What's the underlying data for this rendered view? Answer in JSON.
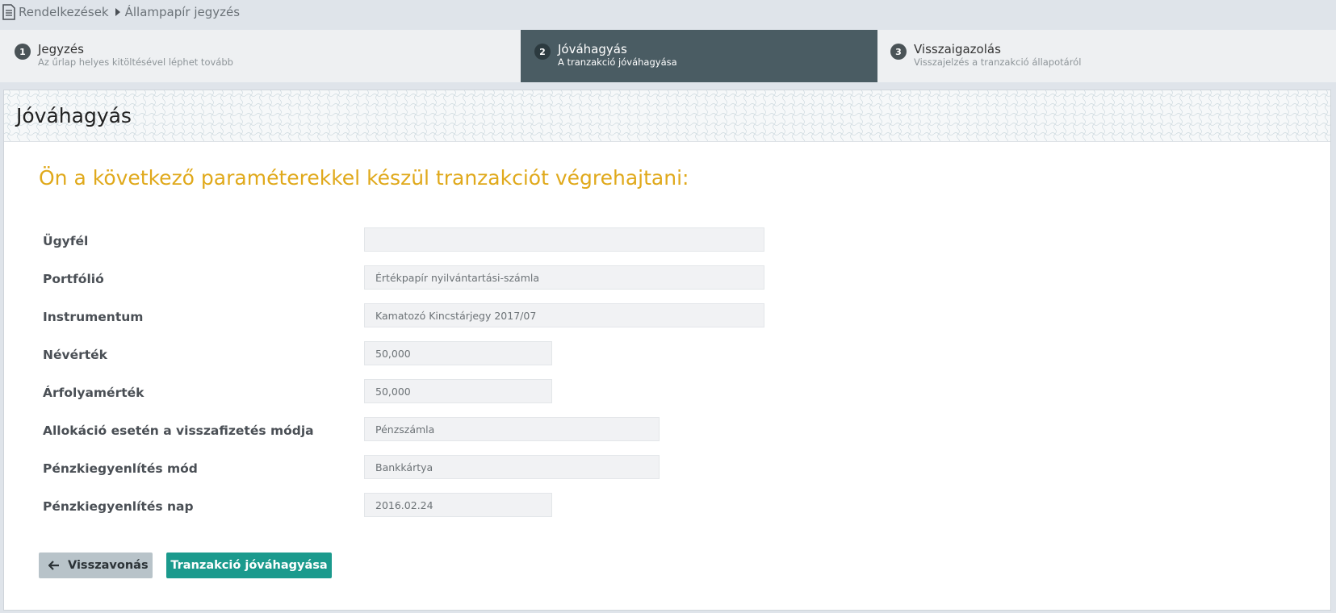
{
  "breadcrumb": {
    "icon": "document-icon",
    "items": [
      "Rendelkezések",
      "Állampapír jegyzés"
    ]
  },
  "steps": [
    {
      "number": "1",
      "title": "Jegyzés",
      "subtitle": "Az űrlap helyes kitöltésével léphet tovább",
      "active": false
    },
    {
      "number": "2",
      "title": "Jóváhagyás",
      "subtitle": "A tranzakció jóváhagyása",
      "active": true
    },
    {
      "number": "3",
      "title": "Visszaigazolás",
      "subtitle": "Visszajelzés a tranzakció állapotáról",
      "active": false
    }
  ],
  "panel": {
    "title": "Jóváhagyás",
    "intro": "Ön a következő paraméterekkel készül tranzakciót végrehajtani:"
  },
  "fields": [
    {
      "label": "Ügyfél",
      "value": ""
    },
    {
      "label": "Portfólió",
      "value": "Értékpapír nyilvántartási-számla"
    },
    {
      "label": "Instrumentum",
      "value": "Kamatozó Kincstárjegy 2017/07"
    },
    {
      "label": "Névérték",
      "value": "50,000"
    },
    {
      "label": "Árfolyamérték",
      "value": "50,000"
    },
    {
      "label": "Allokáció esetén a visszafizetés módja",
      "value": "Pénzszámla"
    },
    {
      "label": "Pénzkiegyenlítés mód",
      "value": "Bankkártya"
    },
    {
      "label": "Pénzkiegyenlítés nap",
      "value": "2016.02.24"
    }
  ],
  "buttons": {
    "back_label": "Visszavonás",
    "back_icon": "arrow-left-icon",
    "confirm_label": "Tranzakció jóváhagyása"
  },
  "colors": {
    "accent": "#e0a91b",
    "active_step": "#4a5c63",
    "confirm_button": "#1b9a8d",
    "back_button": "#b8c3c9"
  }
}
